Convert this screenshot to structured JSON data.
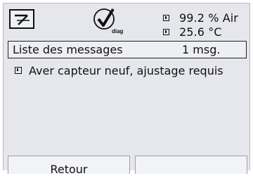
{
  "header": {
    "mode_icon": "measure-mode-icon",
    "diag_icon": "diag-check-icon",
    "diag_label": "diag",
    "readings": [
      {
        "icon": "sensor-indicator-icon",
        "value": "99.2 % Air"
      },
      {
        "icon": "sensor-indicator-icon",
        "value": "25.6 °C"
      }
    ]
  },
  "messages": {
    "title": "Liste des messages",
    "count": "1 msg.",
    "items": [
      {
        "icon": "sensor-indicator-icon",
        "text": "Aver capteur neuf, ajustage requis"
      }
    ]
  },
  "softkeys": {
    "left_label": "Retour",
    "right_label": ""
  }
}
